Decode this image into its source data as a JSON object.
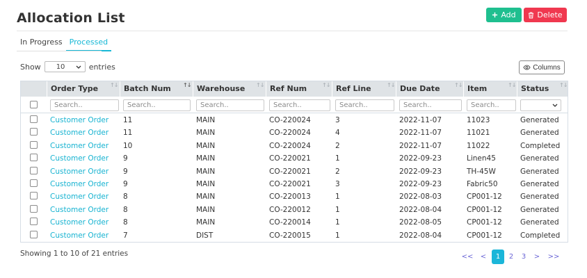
{
  "page": {
    "title": "Allocation List"
  },
  "actions": {
    "add_label": "Add",
    "delete_label": "Delete"
  },
  "tabs": [
    {
      "label": "In Progress",
      "active": false
    },
    {
      "label": "Processed",
      "active": true
    }
  ],
  "length_menu": {
    "show_label": "Show",
    "value": "10",
    "entries_label": "entries"
  },
  "columns_button": {
    "label": "Columns"
  },
  "table": {
    "headers": [
      "Order Type",
      "Batch Num",
      "Warehouse",
      "Ref Num",
      "Ref Line",
      "Due Date",
      "Item",
      "Status"
    ],
    "filter_placeholder": "Search..",
    "rows": [
      {
        "order_type": "Customer Order",
        "batch_num": "11",
        "warehouse": "MAIN",
        "ref_num": "CO-220024",
        "ref_line": "3",
        "due_date": "2022-11-07",
        "item": "11023",
        "status": "Generated"
      },
      {
        "order_type": "Customer Order",
        "batch_num": "11",
        "warehouse": "MAIN",
        "ref_num": "CO-220024",
        "ref_line": "4",
        "due_date": "2022-11-07",
        "item": "11021",
        "status": "Generated"
      },
      {
        "order_type": "Customer Order",
        "batch_num": "10",
        "warehouse": "MAIN",
        "ref_num": "CO-220024",
        "ref_line": "2",
        "due_date": "2022-11-07",
        "item": "11022",
        "status": "Completed"
      },
      {
        "order_type": "Customer Order",
        "batch_num": "9",
        "warehouse": "MAIN",
        "ref_num": "CO-220021",
        "ref_line": "1",
        "due_date": "2022-09-23",
        "item": "Linen45",
        "status": "Generated"
      },
      {
        "order_type": "Customer Order",
        "batch_num": "9",
        "warehouse": "MAIN",
        "ref_num": "CO-220021",
        "ref_line": "2",
        "due_date": "2022-09-23",
        "item": "TH-45W",
        "status": "Generated"
      },
      {
        "order_type": "Customer Order",
        "batch_num": "9",
        "warehouse": "MAIN",
        "ref_num": "CO-220021",
        "ref_line": "3",
        "due_date": "2022-09-23",
        "item": "Fabric50",
        "status": "Generated"
      },
      {
        "order_type": "Customer Order",
        "batch_num": "8",
        "warehouse": "MAIN",
        "ref_num": "CO-220013",
        "ref_line": "1",
        "due_date": "2022-08-03",
        "item": "CP001-12",
        "status": "Generated"
      },
      {
        "order_type": "Customer Order",
        "batch_num": "8",
        "warehouse": "MAIN",
        "ref_num": "CO-220012",
        "ref_line": "1",
        "due_date": "2022-08-04",
        "item": "CP001-12",
        "status": "Generated"
      },
      {
        "order_type": "Customer Order",
        "batch_num": "8",
        "warehouse": "MAIN",
        "ref_num": "CO-220014",
        "ref_line": "1",
        "due_date": "2022-08-05",
        "item": "CP001-12",
        "status": "Generated"
      },
      {
        "order_type": "Customer Order",
        "batch_num": "7",
        "warehouse": "DIST",
        "ref_num": "CO-220015",
        "ref_line": "1",
        "due_date": "2022-08-04",
        "item": "CP001-12",
        "status": "Completed"
      }
    ]
  },
  "footer": {
    "info": "Showing 1 to 10 of 21 entries"
  },
  "pagination": {
    "first": "<<",
    "prev": "<",
    "pages": [
      "1",
      "2",
      "3"
    ],
    "current": "1",
    "next": ">",
    "last": ">>"
  },
  "colors": {
    "accent": "#17b8d6",
    "add": "#1fbf8f",
    "delete": "#f0384f",
    "link": "#17b3d1"
  }
}
